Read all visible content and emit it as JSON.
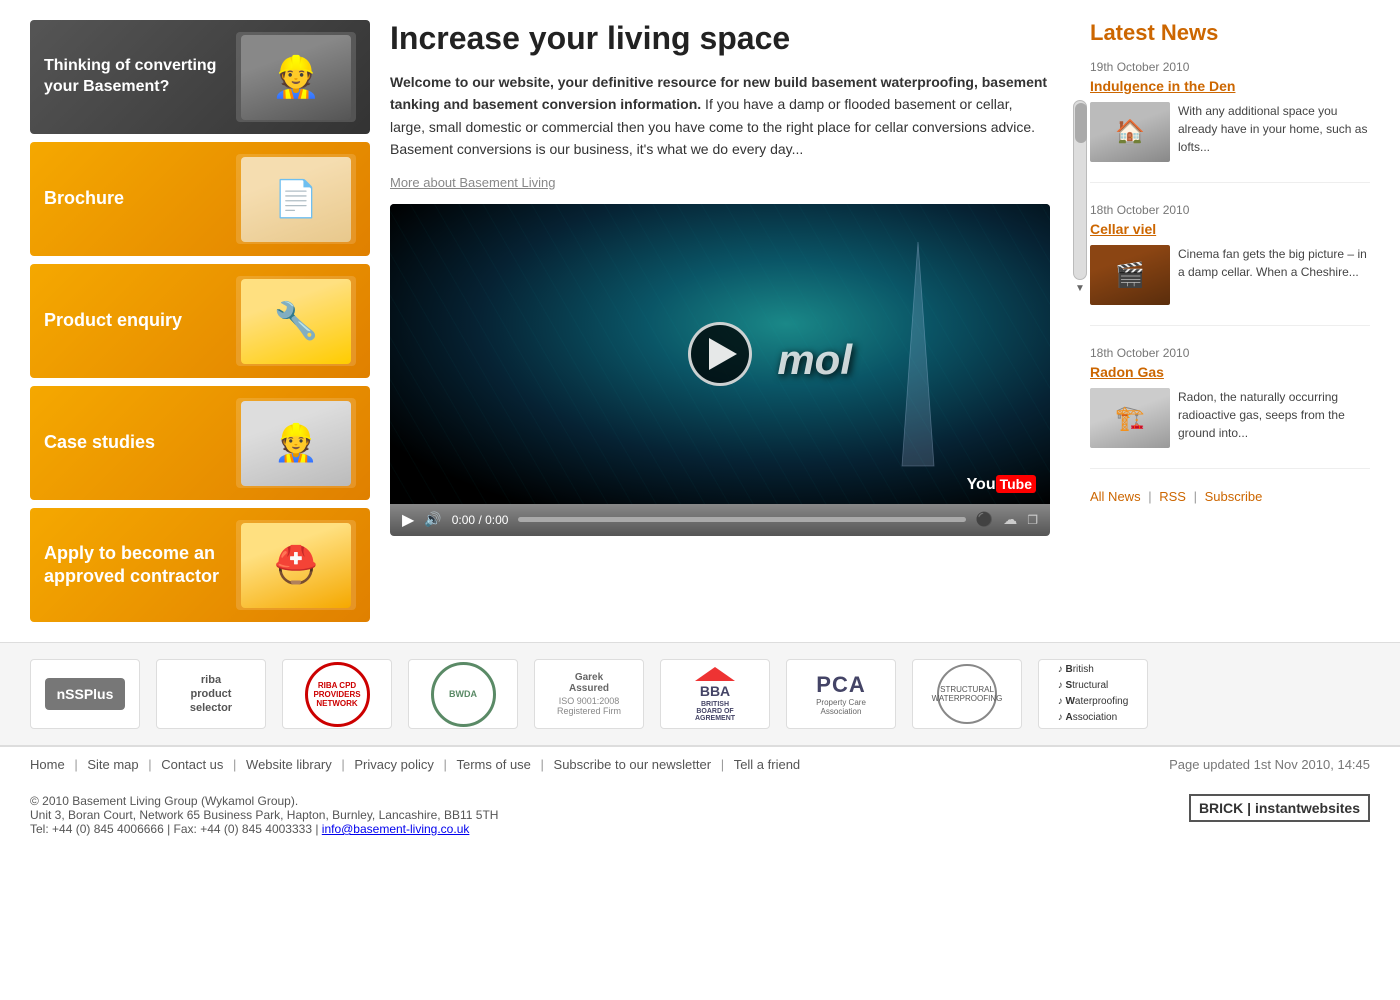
{
  "sidebar": {
    "items": [
      {
        "id": "basement",
        "label": "Thinking of converting your Basement?",
        "icon": "worker-icon",
        "style": "dark"
      },
      {
        "id": "brochure",
        "label": "Brochure",
        "icon": "brochure-icon",
        "style": "amber"
      },
      {
        "id": "product",
        "label": "Product enquiry",
        "icon": "equipment-icon",
        "style": "amber"
      },
      {
        "id": "case",
        "label": "Case studies",
        "icon": "casestudy-icon",
        "style": "amber"
      },
      {
        "id": "contractor",
        "label": "Apply to become an approved contractor",
        "icon": "helmet-icon",
        "style": "amber"
      }
    ]
  },
  "main": {
    "title": "Increase your living space",
    "intro_bold": "Welcome to our website, your definitive resource for new build basement waterproofing, basement tanking and basement conversion information.",
    "intro_rest": " If you have a damp or flooded basement or cellar, large, small domestic or commercial then you have come to the right place for cellar conversions advice. Basement conversions is our business, it's what we do every day...",
    "more_link": "More about Basement Living",
    "video": {
      "mol_text": "mol",
      "time": "0:00 / 0:00",
      "youtube_label": "YouTube"
    }
  },
  "news": {
    "heading": "Latest News",
    "items": [
      {
        "date": "19th October 2010",
        "title": "Indulgence in the Den",
        "thumb_emoji": "🏠",
        "text": "With any additional space you already have in your home, such as lofts..."
      },
      {
        "date": "18th October 2010",
        "title": "Cellar viel",
        "thumb_emoji": "🎬",
        "text": "Cinema fan gets the big picture – in a damp cellar. When a Cheshire..."
      },
      {
        "date": "18th October 2010",
        "title": "Radon Gas",
        "thumb_emoji": "🏗️",
        "text": "Radon, the naturally occurring radioactive gas, seeps from the ground into..."
      }
    ],
    "links": [
      {
        "label": "All News",
        "id": "all-news"
      },
      {
        "label": "RSS",
        "id": "rss"
      },
      {
        "label": "Subscribe",
        "id": "subscribe"
      }
    ]
  },
  "logos": [
    {
      "id": "nssplus",
      "text": "nSSPlus"
    },
    {
      "id": "riba",
      "text": "riba\nproduct\nselector"
    },
    {
      "id": "riba-network",
      "text": "RIBA CPD\nPROVIDERS\nNETWORK"
    },
    {
      "id": "bwda",
      "text": "BWDA"
    },
    {
      "id": "iso",
      "text": "ISO 9001:2008\nRegistered Firm"
    },
    {
      "id": "bba",
      "text": "BBA\nBRITISH\nBOARD OF\nAGREMENT"
    },
    {
      "id": "pca",
      "text": "PCA\nProperty Care\nAssociation"
    },
    {
      "id": "sswa",
      "text": "Structural\nWaterproofing\nAssociation"
    },
    {
      "id": "bswa",
      "text": "British\nStructural\nWaterproofing\nAssociation"
    }
  ],
  "footer": {
    "nav_links": [
      {
        "label": "Home",
        "id": "home"
      },
      {
        "label": "Site map",
        "id": "sitemap"
      },
      {
        "label": "Contact us",
        "id": "contact"
      },
      {
        "label": "Website library",
        "id": "library"
      },
      {
        "label": "Privacy policy",
        "id": "privacy"
      },
      {
        "label": "Terms of use",
        "id": "terms"
      },
      {
        "label": "Subscribe to our newsletter",
        "id": "newsletter"
      },
      {
        "label": "Tell a friend",
        "id": "friend"
      }
    ],
    "updated": "Page updated 1st Nov 2010, 14:45",
    "copyright": "© 2010 Basement Living Group (Wykamol Group).",
    "address": "Unit 3, Boran Court, Network 65 Business Park, Hapton, Burnley, Lancashire, BB11 5TH",
    "tel": "Tel: +44 (0) 845 4006666 | Fax: +44 (0) 845 4003333 | info@basement-living.co.uk",
    "brand": "BRICK | instantwebsites"
  }
}
